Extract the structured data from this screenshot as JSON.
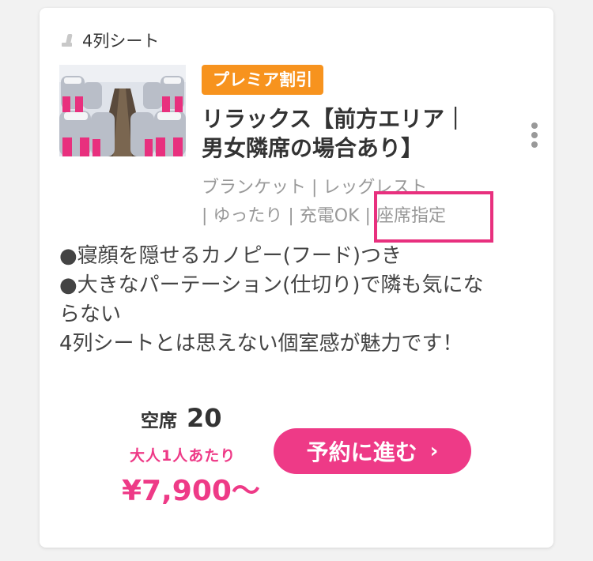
{
  "seat_type": "4列シート",
  "badge": "プレミア割引",
  "plan_title": "リラックス【前方エリア｜\n男女隣席の場合あり】",
  "amenities": "ブランケット | レッグレスト\n | ゆったり | 充電OK | 座席指定",
  "description": "●寝顔を隠せるカノピー(フード)つき\n●大きなパーテーション(仕切り)で隣も気にな\nらない\n4列シートとは思えない個室感が魅力です！",
  "vacancy": {
    "label": "空席",
    "count": "20"
  },
  "price_note": "大人1人あたり",
  "price": "¥7,900～",
  "reserve_button": {
    "label": "予約に進む",
    "icon": "chevron-right-icon"
  },
  "colors": {
    "accent": "#ee3a87",
    "badge": "#f7931e",
    "highlight": "#e8307e"
  }
}
